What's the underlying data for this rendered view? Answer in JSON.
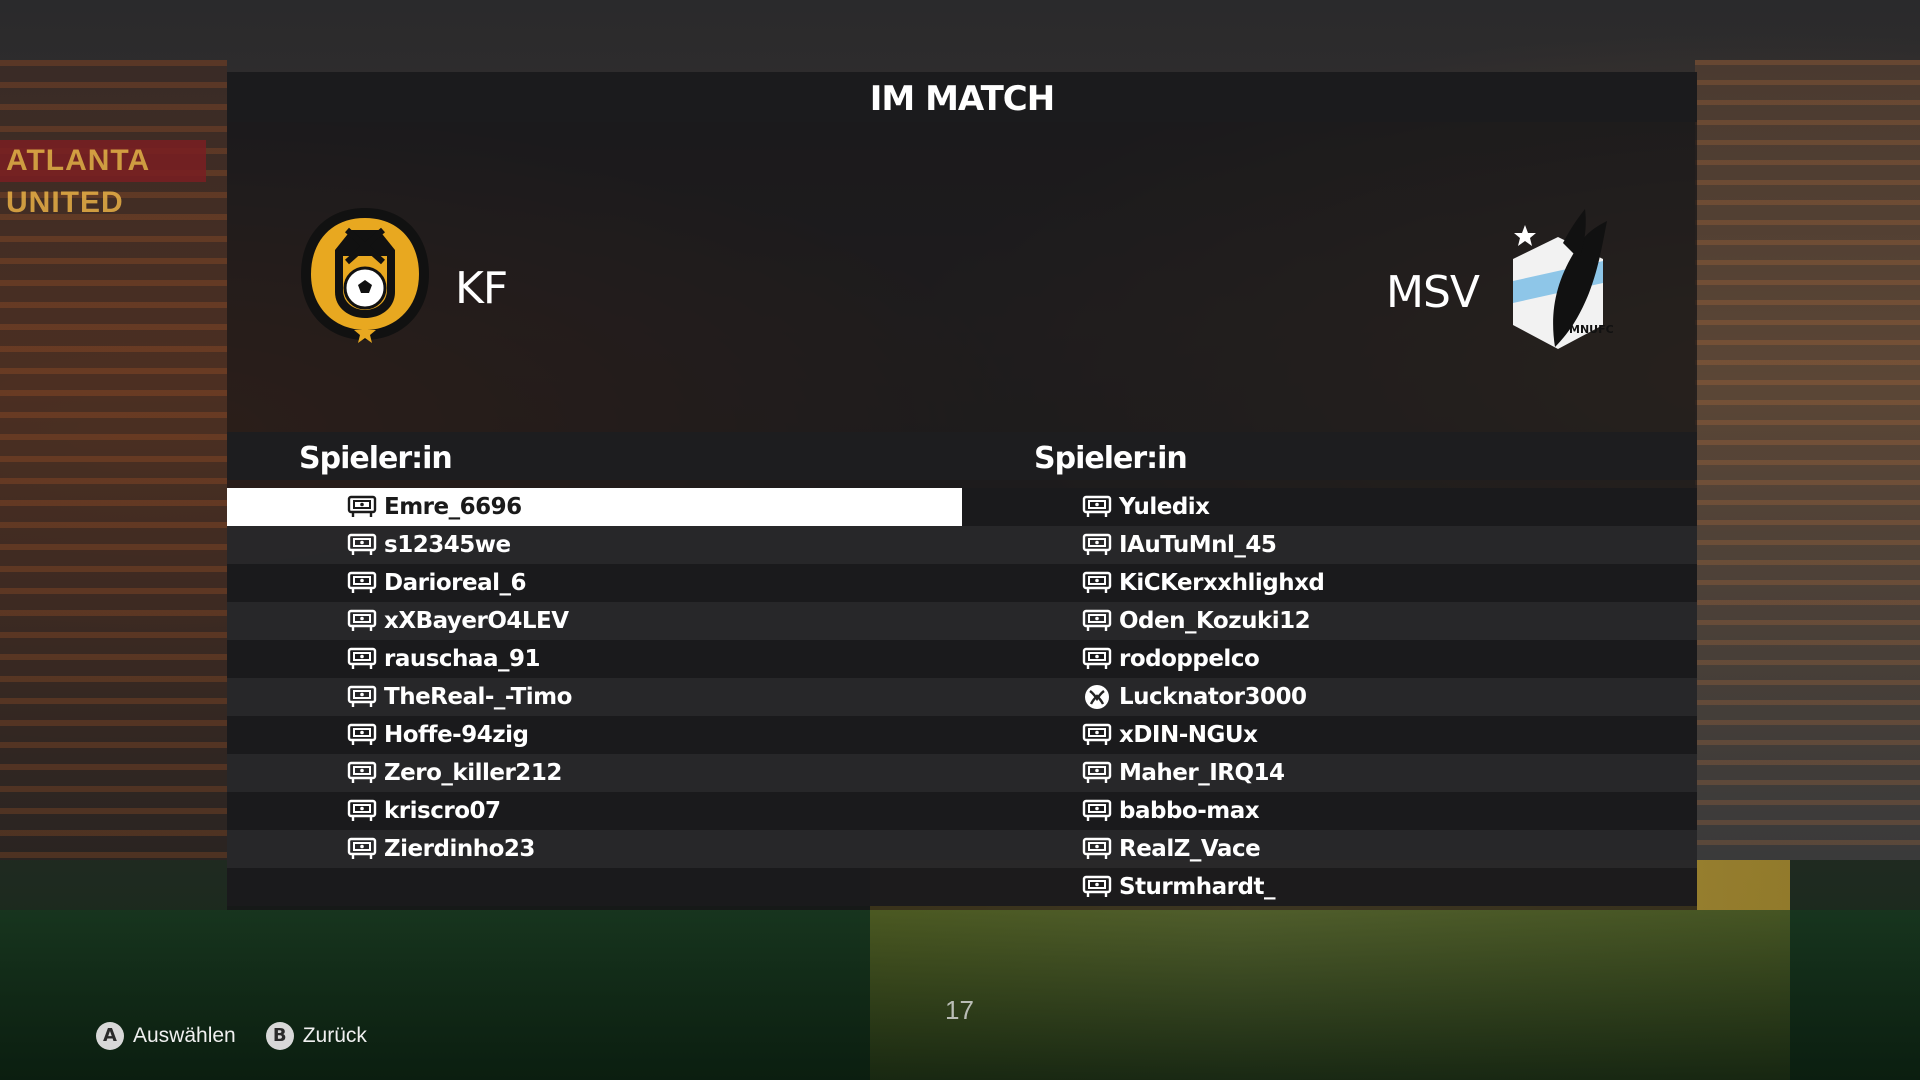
{
  "screen": {
    "title": "IM MATCH",
    "background_number": "17"
  },
  "home_team": {
    "name": "KF"
  },
  "away_team": {
    "name": "MSV",
    "crest_text": "MNUFC"
  },
  "columns": {
    "left_header": "Spieler:in",
    "right_header": "Spieler:in"
  },
  "home_players": [
    {
      "name": "Emre_6696",
      "platform": "playstation-icon",
      "selected": true
    },
    {
      "name": "s12345we",
      "platform": "playstation-icon"
    },
    {
      "name": "Darioreal_6",
      "platform": "playstation-icon"
    },
    {
      "name": "xXBayerO4LEV",
      "platform": "playstation-icon"
    },
    {
      "name": "rauschaa_91",
      "platform": "playstation-icon"
    },
    {
      "name": "TheReal-_-Timo",
      "platform": "playstation-icon"
    },
    {
      "name": "Hoffe-94zig",
      "platform": "playstation-icon"
    },
    {
      "name": "Zero_killer212",
      "platform": "playstation-icon"
    },
    {
      "name": "kriscro07",
      "platform": "playstation-icon"
    },
    {
      "name": "Zierdinho23",
      "platform": "playstation-icon"
    }
  ],
  "away_players": [
    {
      "name": "Yuledix",
      "platform": "playstation-icon"
    },
    {
      "name": "IAuTuMnl_45",
      "platform": "playstation-icon"
    },
    {
      "name": "KiCKerxxhlighxd",
      "platform": "playstation-icon"
    },
    {
      "name": "Oden_Kozuki12",
      "platform": "playstation-icon"
    },
    {
      "name": "rodoppelco",
      "platform": "playstation-icon"
    },
    {
      "name": "Lucknator3000",
      "platform": "xbox-icon"
    },
    {
      "name": "xDIN-NGUx",
      "platform": "playstation-icon"
    },
    {
      "name": "Maher_IRQ14",
      "platform": "playstation-icon"
    },
    {
      "name": "babbo-max",
      "platform": "playstation-icon"
    },
    {
      "name": "RealZ_Vace",
      "platform": "playstation-icon"
    },
    {
      "name": "Sturmhardt_",
      "platform": "playstation-icon"
    }
  ],
  "footer": {
    "select_button": "A",
    "select_label": "Auswählen",
    "back_button": "B",
    "back_label": "Zurück"
  },
  "colors": {
    "accent_gold": "#e8a820",
    "selected_row": "#ffffff",
    "panel": "#1b1b1d"
  }
}
